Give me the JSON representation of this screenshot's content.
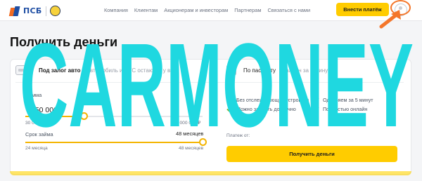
{
  "header": {
    "brand": "ПСБ",
    "nav": [
      "Компания",
      "Клиентам",
      "Акционерам и инвесторам",
      "Партнерам",
      "Связаться с нами"
    ],
    "pay_button": "Внести платёж"
  },
  "page_title": "Получить деньги",
  "tabs": {
    "left": {
      "label": "Под залог авто",
      "sub": "Автомобиль и ПТС остаются у вас"
    },
    "right": {
      "label": "По паспорту",
      "sub": "Онлайн за 5 минут"
    }
  },
  "amount": {
    "label": "Сумма",
    "value": "350 000 ₽",
    "min": "30 000 ₽",
    "max": "1 000 000 ₽",
    "fraction": 0.33
  },
  "term": {
    "label": "Срок займа",
    "value": "48 месяцев",
    "min": "24 месяца",
    "max": "48 месяцев",
    "fraction": 1.0
  },
  "features": [
    "Без отслеживающих устройств",
    "Одобряем за 5 минут",
    "Можно закрыть досрочно",
    "Полностью онлайн"
  ],
  "payment_label": "Платеж от:",
  "cta_button": "Получить деньги",
  "watermark": "CARMONEY",
  "colors": {
    "accent": "#ffcc00",
    "check": "#7cb82f",
    "watermark": "#1fd8e0",
    "annotation": "#f4762a"
  }
}
